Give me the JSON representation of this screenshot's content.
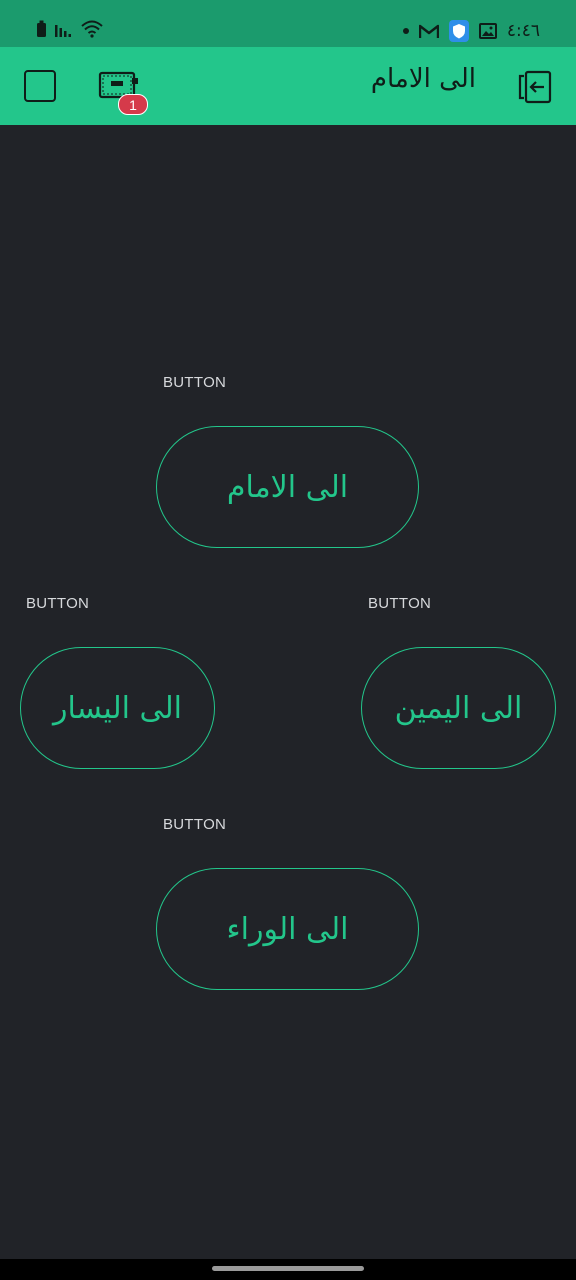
{
  "status_bar": {
    "time": "٤:٤٦",
    "icons": [
      "battery-icon",
      "signal-icon",
      "wifi-icon",
      "notification-dot-icon",
      "gmail-icon",
      "shield-icon",
      "gallery-icon"
    ]
  },
  "app_bar": {
    "title": "الى الامام",
    "device_badge": "1",
    "icons": [
      "stop-square-icon",
      "device-icon",
      "exit-icon"
    ]
  },
  "widgets": [
    {
      "label": "BUTTON",
      "text": "الى الامام"
    },
    {
      "label": "BUTTON",
      "text": "الى اليسار"
    },
    {
      "label": "BUTTON",
      "text": "الى اليمين"
    },
    {
      "label": "BUTTON",
      "text": "الى الوراء"
    }
  ],
  "colors": {
    "accent": "#23c68b",
    "status_bar": "#1b9b6d",
    "background": "#212328",
    "badge": "#d53a4a"
  }
}
